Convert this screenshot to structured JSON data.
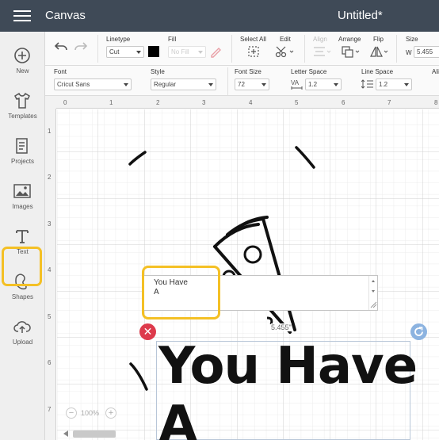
{
  "app": {
    "title": "Canvas",
    "document_title": "Untitled*"
  },
  "sidebar": {
    "items": [
      {
        "label": "New",
        "icon": "plus-circle-icon"
      },
      {
        "label": "Templates",
        "icon": "tshirt-icon"
      },
      {
        "label": "Projects",
        "icon": "projects-icon"
      },
      {
        "label": "Images",
        "icon": "image-icon"
      },
      {
        "label": "Text",
        "icon": "text-t-icon"
      },
      {
        "label": "Shapes",
        "icon": "shapes-icon"
      },
      {
        "label": "Upload",
        "icon": "cloud-upload-icon"
      }
    ]
  },
  "toolbar": {
    "linetype_label": "Linetype",
    "linetype_value": "Cut",
    "fill_label": "Fill",
    "fill_value": "No Fill",
    "select_all_label": "Select All",
    "edit_label": "Edit",
    "align_label": "Align",
    "arrange_label": "Arrange",
    "flip_label": "Flip",
    "size_label": "Size",
    "size_w_label": "W",
    "size_w_value": "5.455",
    "fill_color": "#000000"
  },
  "text_toolbar": {
    "font_label": "Font",
    "font_value": "Cricut Sans",
    "style_label": "Style",
    "style_value": "Regular",
    "font_size_label": "Font Size",
    "font_size_value": "72",
    "letter_space_label": "Letter Space",
    "letter_space_value": "1.2",
    "line_space_label": "Line Space",
    "line_space_value": "1.2",
    "align_label": "Ali"
  },
  "ruler": {
    "top": [
      "0",
      "1",
      "2",
      "3",
      "4",
      "5",
      "6",
      "7",
      "8"
    ],
    "left": [
      "1",
      "2",
      "3",
      "4",
      "5",
      "6",
      "7"
    ]
  },
  "canvas": {
    "text_editor_line1": "You Have",
    "text_editor_line2": "A",
    "width_tag": "5.455\"",
    "big_text": "You Have\nA",
    "zoom_value": "100%",
    "zoom_minus": "−",
    "zoom_plus": "+"
  },
  "colors": {
    "topbar": "#3f4a57",
    "highlight": "#f4c025",
    "delete": "#dd3a4c",
    "rotate": "#8cb3e0"
  }
}
